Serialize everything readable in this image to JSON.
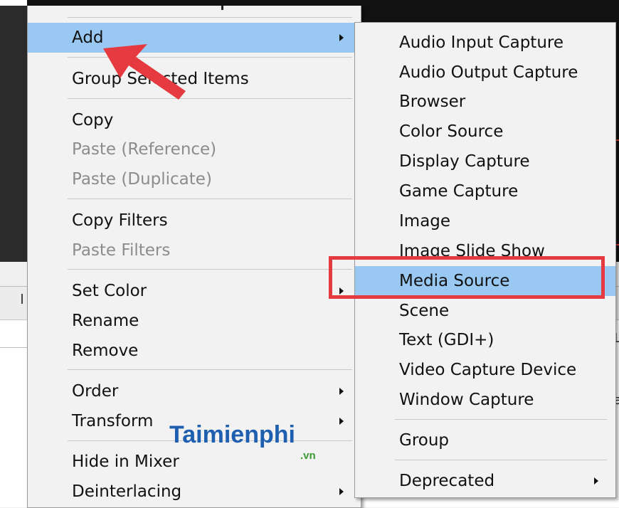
{
  "main_menu": {
    "items": [
      {
        "label": "Add",
        "submenu": true,
        "highlighted": true
      },
      {
        "label": "Group Selected Items"
      },
      {
        "label": "Copy"
      },
      {
        "label": "Paste (Reference)",
        "disabled": true
      },
      {
        "label": "Paste (Duplicate)",
        "disabled": true
      },
      {
        "label": "Copy Filters"
      },
      {
        "label": "Paste Filters",
        "disabled": true
      },
      {
        "label": "Set Color",
        "submenu": true
      },
      {
        "label": "Rename"
      },
      {
        "label": "Remove"
      },
      {
        "label": "Order",
        "submenu": true
      },
      {
        "label": "Transform",
        "submenu": true
      },
      {
        "label": "Hide in Mixer"
      },
      {
        "label": "Deinterlacing",
        "submenu": true
      }
    ]
  },
  "add_submenu": {
    "items": [
      {
        "label": "Audio Input Capture"
      },
      {
        "label": "Audio Output Capture"
      },
      {
        "label": "Browser"
      },
      {
        "label": "Color Source"
      },
      {
        "label": "Display Capture"
      },
      {
        "label": "Game Capture"
      },
      {
        "label": "Image"
      },
      {
        "label": "Image Slide Show"
      },
      {
        "label": "Media Source",
        "highlighted": true
      },
      {
        "label": "Scene"
      },
      {
        "label": "Text (GDI+)"
      },
      {
        "label": "Video Capture Device"
      },
      {
        "label": "Window Capture"
      },
      {
        "label": "Group"
      },
      {
        "label": "Deprecated",
        "submenu": true
      }
    ]
  },
  "watermark": {
    "brand": "Taimienphi",
    "tld": ".vn"
  },
  "colors": {
    "highlight": "#99c9f2",
    "annotation": "#e53a3f",
    "menu_bg": "#f2f2f2"
  }
}
